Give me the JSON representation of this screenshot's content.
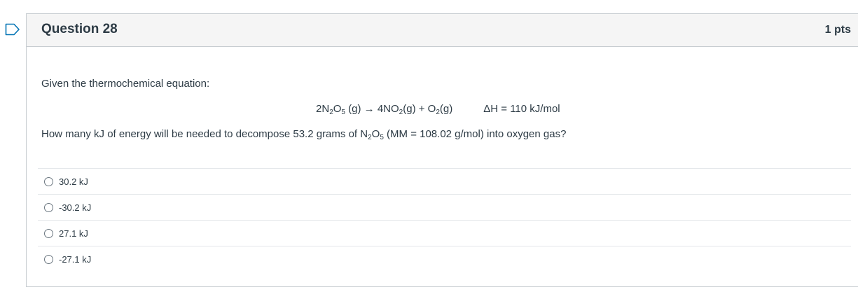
{
  "question": {
    "title": "Question 28",
    "points": "1 pts",
    "intro": "Given the thermochemical equation:",
    "equation": {
      "t1": "2N",
      "s1": "2",
      "t2": "O",
      "s2": "5",
      "t3": " (g) → 4NO",
      "s3": "2",
      "t4": "(g) + O",
      "s4": "2",
      "t5": "(g)",
      "delta_h": "ΔH = 110 kJ/mol"
    },
    "prompt": {
      "t1": "How many kJ of energy will be needed to decompose 53.2 grams of N",
      "s1": "2",
      "t2": "O",
      "s2": "5",
      "t3": " (MM = 108.02 g/mol) into oxygen gas?"
    },
    "answers": [
      {
        "label": "30.2 kJ",
        "selected": false
      },
      {
        "label": "-30.2 kJ",
        "selected": false
      },
      {
        "label": "27.1 kJ",
        "selected": false
      },
      {
        "label": "-27.1 kJ",
        "selected": false
      }
    ]
  },
  "colors": {
    "flag": "#0374b5",
    "header_bg": "#f5f5f5",
    "border": "#c7cdd1",
    "text": "#2d3b45"
  }
}
